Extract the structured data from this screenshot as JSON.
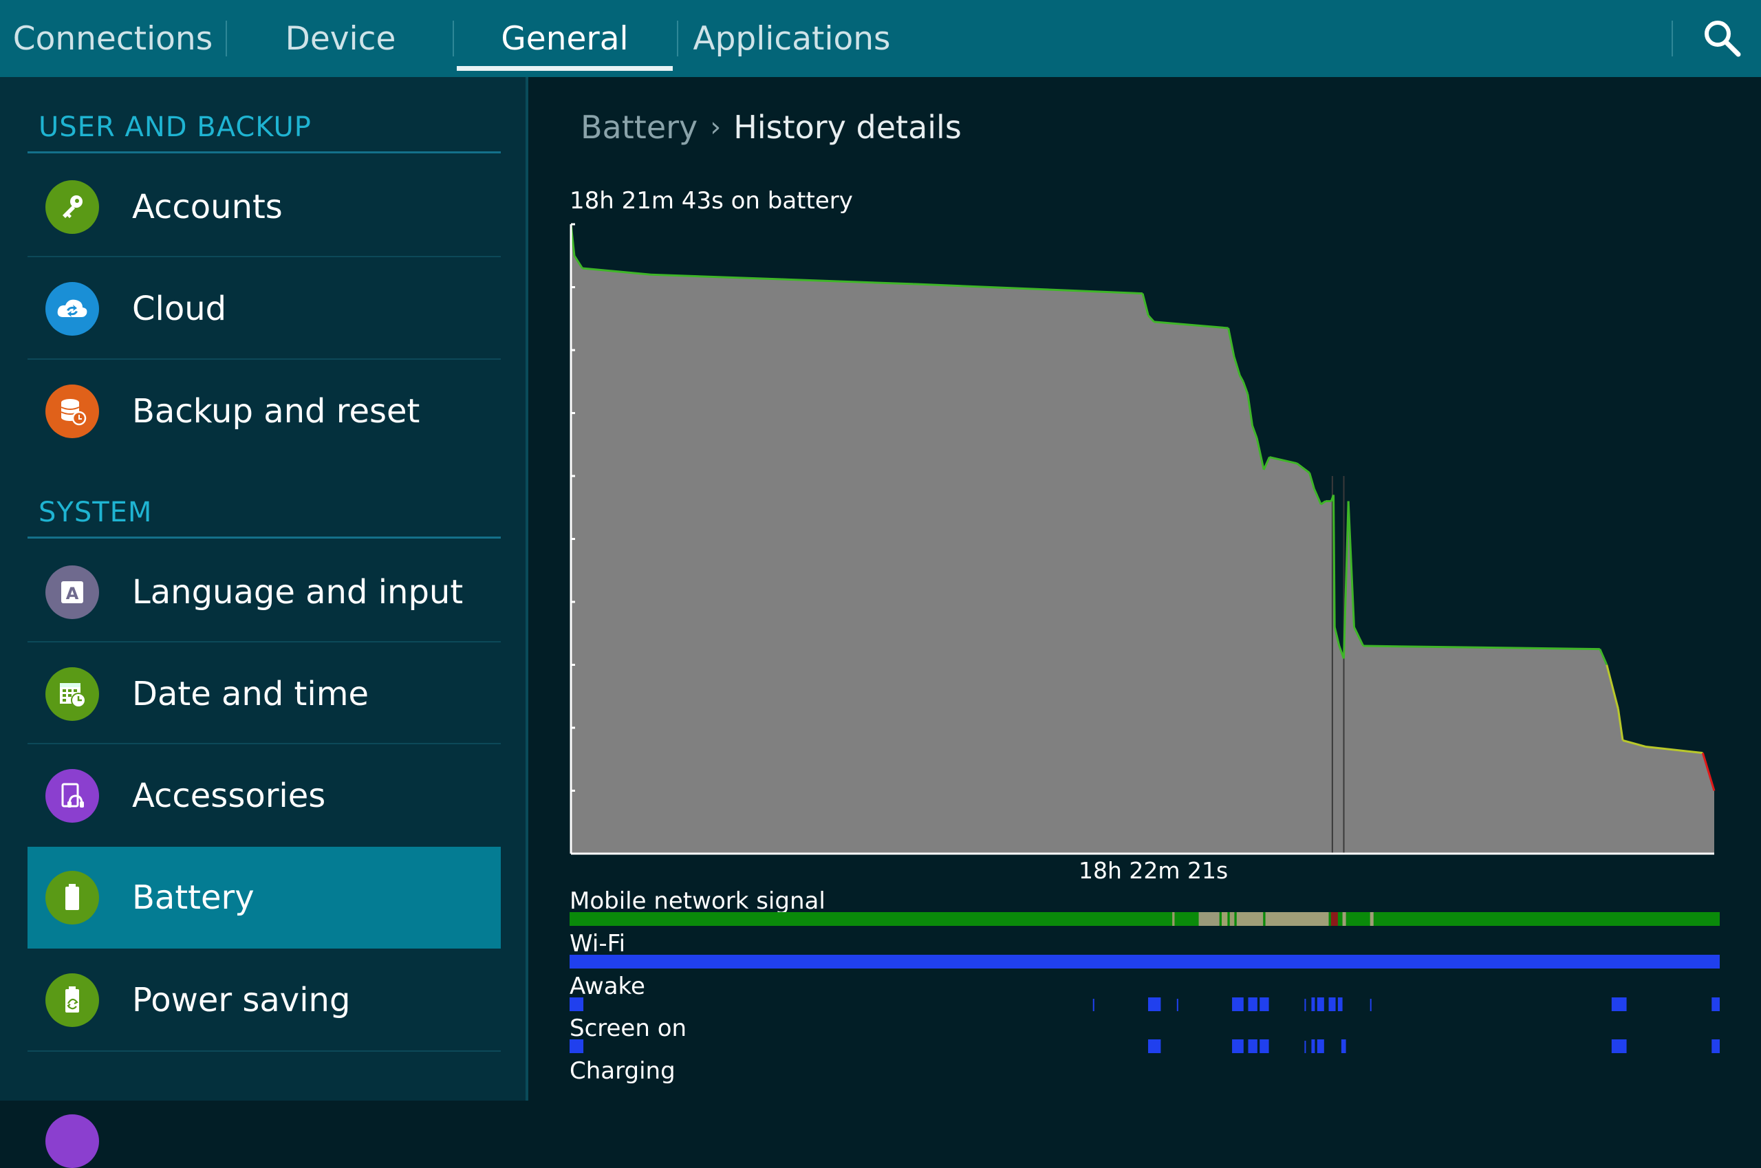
{
  "tabs": [
    {
      "label": "Connections",
      "active": false
    },
    {
      "label": "Device",
      "active": false
    },
    {
      "label": "General",
      "active": true
    },
    {
      "label": "Applications",
      "active": false
    }
  ],
  "search_icon": "search-icon",
  "sidebar": {
    "sections": [
      {
        "header": "USER AND BACKUP",
        "items": [
          {
            "label": "Accounts",
            "icon": "key-icon",
            "color": "#5a9a16"
          },
          {
            "label": "Cloud",
            "icon": "cloud-sync-icon",
            "color": "#1a8fd6"
          },
          {
            "label": "Backup and reset",
            "icon": "backup-icon",
            "color": "#e0611a"
          }
        ]
      },
      {
        "header": "SYSTEM",
        "items": [
          {
            "label": "Language and input",
            "icon": "language-icon",
            "color": "#6f6a8e"
          },
          {
            "label": "Date and time",
            "icon": "calendar-clock-icon",
            "color": "#5a9a16"
          },
          {
            "label": "Accessories",
            "icon": "accessories-icon",
            "color": "#8b3fcf"
          },
          {
            "label": "Battery",
            "icon": "battery-icon",
            "color": "#5a9a16",
            "selected": true
          },
          {
            "label": "Power saving",
            "icon": "power-saving-icon",
            "color": "#5a9a16"
          }
        ]
      }
    ]
  },
  "breadcrumb": {
    "parent": "Battery",
    "current": "History details"
  },
  "chart_data": {
    "type": "area",
    "title": "18h 21m 43s on battery",
    "xlabel": "18h 22m 21s",
    "ylabel": "",
    "x_unit": "fraction of elapsed time",
    "y_unit": "battery level %",
    "ylim": [
      0,
      100
    ],
    "grid": false,
    "series_color": "#3fb628",
    "fill_color": "#808080",
    "x": [
      0,
      0.003,
      0.01,
      0.07,
      0.3,
      0.5,
      0.505,
      0.51,
      0.575,
      0.58,
      0.585,
      0.588,
      0.592,
      0.596,
      0.6,
      0.606,
      0.611,
      0.635,
      0.646,
      0.65,
      0.656,
      0.66,
      0.665,
      0.667,
      0.668,
      0.672,
      0.676,
      0.68,
      0.685,
      0.693,
      0.9,
      0.906,
      0.916,
      0.92,
      0.94,
      0.99,
      1.0
    ],
    "y": [
      100,
      95,
      93,
      92,
      90.5,
      89,
      85.5,
      84.5,
      83.5,
      79,
      76,
      75,
      73,
      68,
      66,
      61,
      63,
      62,
      60.5,
      58,
      55.5,
      56,
      56,
      57,
      36,
      33,
      31,
      56,
      36,
      33,
      32.5,
      30,
      23,
      18,
      17,
      16,
      10
    ],
    "gaps": [
      {
        "from": 0.666,
        "to": 0.676
      }
    ],
    "tracks": [
      {
        "name": "Mobile network signal",
        "type": "band",
        "base_color": "#0a8a0a",
        "segments": [
          {
            "from": 0.524,
            "to": 0.526,
            "color": "#9a9a6a"
          },
          {
            "from": 0.547,
            "to": 0.565,
            "color": "#9a9a7a"
          },
          {
            "from": 0.567,
            "to": 0.572,
            "color": "#a0a070"
          },
          {
            "from": 0.574,
            "to": 0.578,
            "color": "#9a9a70"
          },
          {
            "from": 0.58,
            "to": 0.603,
            "color": "#a09e78"
          },
          {
            "from": 0.605,
            "to": 0.66,
            "color": "#a09e78"
          },
          {
            "from": 0.662,
            "to": 0.668,
            "color": "#8c1a1a"
          },
          {
            "from": 0.672,
            "to": 0.675,
            "color": "#a09e78"
          },
          {
            "from": 0.696,
            "to": 0.699,
            "color": "#a09e78"
          }
        ]
      },
      {
        "name": "Wi-Fi",
        "type": "band",
        "base_color": "#2040ee",
        "segments": []
      },
      {
        "name": "Awake",
        "type": "blocks",
        "color": "#2040ee",
        "segments": [
          {
            "from": 0.0,
            "to": 0.012
          },
          {
            "from": 0.455,
            "to": 0.456
          },
          {
            "from": 0.503,
            "to": 0.514
          },
          {
            "from": 0.528,
            "to": 0.529
          },
          {
            "from": 0.576,
            "to": 0.586
          },
          {
            "from": 0.59,
            "to": 0.598
          },
          {
            "from": 0.6,
            "to": 0.608
          },
          {
            "from": 0.639,
            "to": 0.64
          },
          {
            "from": 0.645,
            "to": 0.648
          },
          {
            "from": 0.65,
            "to": 0.656
          },
          {
            "from": 0.66,
            "to": 0.666
          },
          {
            "from": 0.668,
            "to": 0.672
          },
          {
            "from": 0.696,
            "to": 0.697
          },
          {
            "from": 0.906,
            "to": 0.919
          },
          {
            "from": 0.993,
            "to": 1.0
          }
        ]
      },
      {
        "name": "Screen on",
        "type": "blocks",
        "color": "#2040ee",
        "segments": [
          {
            "from": 0.0,
            "to": 0.012
          },
          {
            "from": 0.503,
            "to": 0.514
          },
          {
            "from": 0.576,
            "to": 0.586
          },
          {
            "from": 0.59,
            "to": 0.598
          },
          {
            "from": 0.6,
            "to": 0.608
          },
          {
            "from": 0.639,
            "to": 0.64
          },
          {
            "from": 0.645,
            "to": 0.648
          },
          {
            "from": 0.65,
            "to": 0.656
          },
          {
            "from": 0.671,
            "to": 0.675
          },
          {
            "from": 0.906,
            "to": 0.919
          },
          {
            "from": 0.993,
            "to": 1.0
          }
        ]
      },
      {
        "name": "Charging",
        "type": "blocks",
        "color": "#2040ee",
        "segments": []
      }
    ]
  }
}
